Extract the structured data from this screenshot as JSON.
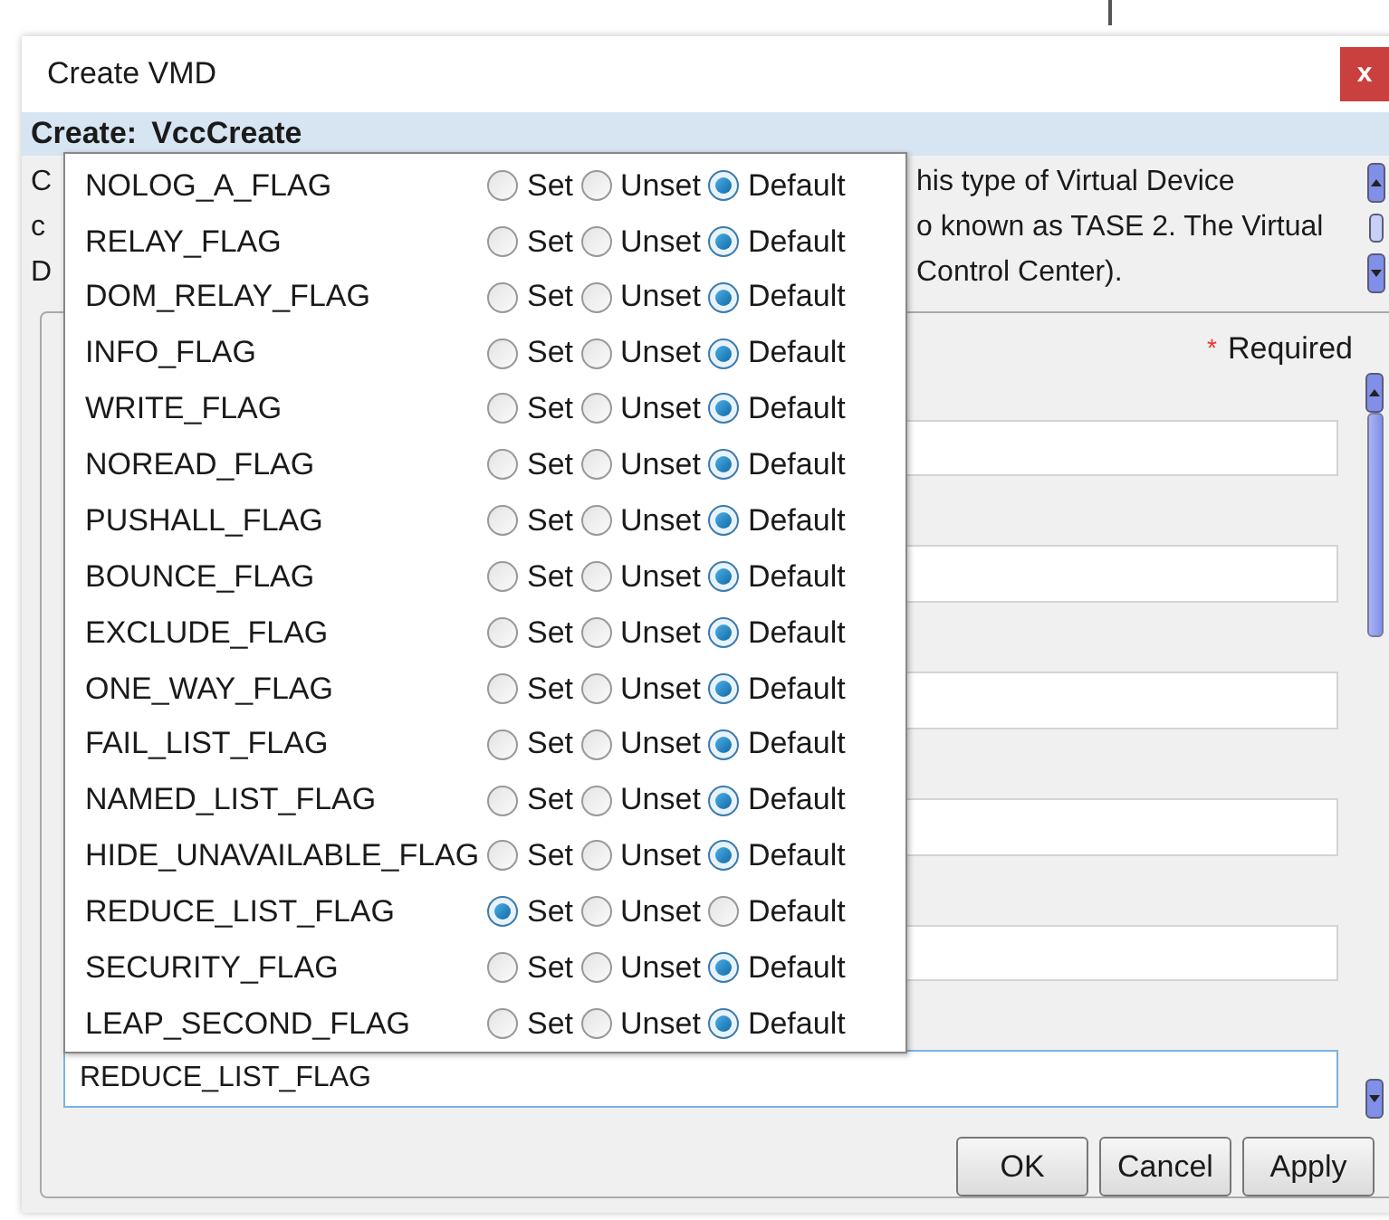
{
  "window": {
    "title": "Create VMD",
    "close": "x"
  },
  "header": {
    "label": "Create:",
    "value": "VccCreate"
  },
  "description": [
    {
      "left": "C",
      "right": "his type of Virtual Device"
    },
    {
      "left": "c",
      "right": "o known as TASE 2. The Virtual"
    },
    {
      "left": "D",
      "right": "Control Center)."
    }
  ],
  "required": {
    "mark": "*",
    "label": "Required"
  },
  "fields": [
    {
      "focused": false
    },
    {
      "focused": false
    },
    {
      "focused": false
    },
    {
      "focused": false
    },
    {
      "focused": false
    },
    {
      "value": "REDUCE_LIST_FLAG",
      "focused": true
    }
  ],
  "flags": [
    {
      "name": "NOLOG_A_FLAG",
      "options": [
        {
          "label": "Set",
          "selected": false
        },
        {
          "label": "Unset",
          "selected": false
        },
        {
          "label": "Default",
          "selected": true
        }
      ]
    },
    {
      "name": "RELAY_FLAG",
      "options": [
        {
          "label": "Set",
          "selected": false
        },
        {
          "label": "Unset",
          "selected": false
        },
        {
          "label": "Default",
          "selected": true
        }
      ]
    },
    {
      "name": "DOM_RELAY_FLAG",
      "options": [
        {
          "label": "Set",
          "selected": false
        },
        {
          "label": "Unset",
          "selected": false
        },
        {
          "label": "Default",
          "selected": true
        }
      ]
    },
    {
      "name": "INFO_FLAG",
      "options": [
        {
          "label": "Set",
          "selected": false
        },
        {
          "label": "Unset",
          "selected": false
        },
        {
          "label": "Default",
          "selected": true
        }
      ]
    },
    {
      "name": "WRITE_FLAG",
      "options": [
        {
          "label": "Set",
          "selected": false
        },
        {
          "label": "Unset",
          "selected": false
        },
        {
          "label": "Default",
          "selected": true
        }
      ]
    },
    {
      "name": "NOREAD_FLAG",
      "options": [
        {
          "label": "Set",
          "selected": false
        },
        {
          "label": "Unset",
          "selected": false
        },
        {
          "label": "Default",
          "selected": true
        }
      ]
    },
    {
      "name": "PUSHALL_FLAG",
      "options": [
        {
          "label": "Set",
          "selected": false
        },
        {
          "label": "Unset",
          "selected": false
        },
        {
          "label": "Default",
          "selected": true
        }
      ]
    },
    {
      "name": "BOUNCE_FLAG",
      "options": [
        {
          "label": "Set",
          "selected": false
        },
        {
          "label": "Unset",
          "selected": false
        },
        {
          "label": "Default",
          "selected": true
        }
      ]
    },
    {
      "name": "EXCLUDE_FLAG",
      "options": [
        {
          "label": "Set",
          "selected": false
        },
        {
          "label": "Unset",
          "selected": false
        },
        {
          "label": "Default",
          "selected": true
        }
      ]
    },
    {
      "name": "ONE_WAY_FLAG",
      "options": [
        {
          "label": "Set",
          "selected": false
        },
        {
          "label": "Unset",
          "selected": false
        },
        {
          "label": "Default",
          "selected": true
        }
      ]
    },
    {
      "name": "FAIL_LIST_FLAG",
      "options": [
        {
          "label": "Set",
          "selected": false
        },
        {
          "label": "Unset",
          "selected": false
        },
        {
          "label": "Default",
          "selected": true
        }
      ]
    },
    {
      "name": "NAMED_LIST_FLAG",
      "options": [
        {
          "label": "Set",
          "selected": false
        },
        {
          "label": "Unset",
          "selected": false
        },
        {
          "label": "Default",
          "selected": true
        }
      ]
    },
    {
      "name": "HIDE_UNAVAILABLE_FLAG",
      "options": [
        {
          "label": "Set",
          "selected": false
        },
        {
          "label": "Unset",
          "selected": false
        },
        {
          "label": "Default",
          "selected": true
        }
      ]
    },
    {
      "name": "REDUCE_LIST_FLAG",
      "options": [
        {
          "label": "Set",
          "selected": true
        },
        {
          "label": "Unset",
          "selected": false
        },
        {
          "label": "Default",
          "selected": false
        }
      ]
    },
    {
      "name": "SECURITY_FLAG",
      "options": [
        {
          "label": "Set",
          "selected": false
        },
        {
          "label": "Unset",
          "selected": false
        },
        {
          "label": "Default",
          "selected": true
        }
      ]
    },
    {
      "name": "LEAP_SECOND_FLAG",
      "options": [
        {
          "label": "Set",
          "selected": false
        },
        {
          "label": "Unset",
          "selected": false
        },
        {
          "label": "Default",
          "selected": true
        }
      ]
    }
  ],
  "buttons": [
    "OK",
    "Cancel",
    "Apply"
  ]
}
